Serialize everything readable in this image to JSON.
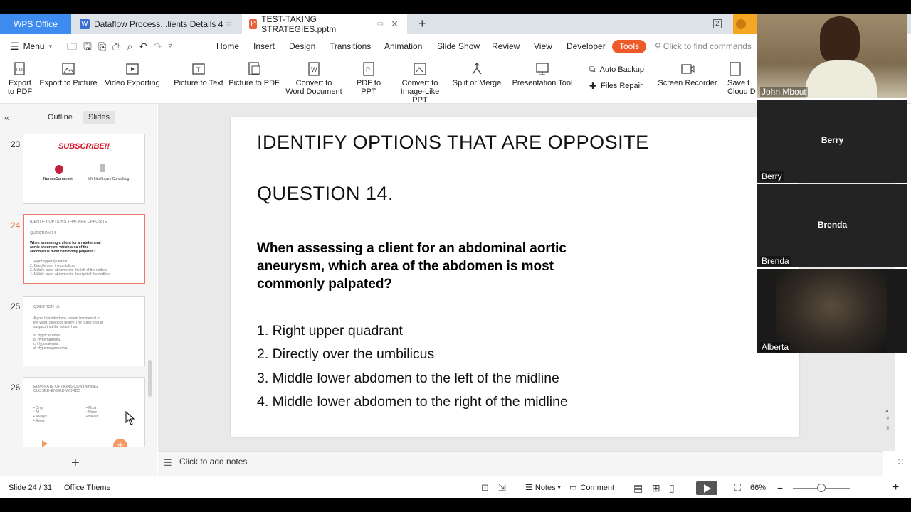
{
  "tabs": {
    "wps": "WPS Office",
    "doc": "Dataflow Process...lients Details 4",
    "ppt": "TEST-TAKING STRATEGIES.pptm",
    "add": "+"
  },
  "menu": {
    "main": "Menu",
    "items": [
      "Home",
      "Insert",
      "Design",
      "Transitions",
      "Animation",
      "Slide Show",
      "Review",
      "View",
      "Developer",
      "Tools"
    ],
    "search": "Click to find commands"
  },
  "ribbon": {
    "export_pdf_1": "Export",
    "export_pdf_2": "to PDF",
    "export_picture": "Export to Picture",
    "video_exporting": "Video Exporting",
    "picture_to_text": "Picture to Text",
    "picture_to_pdf": "Picture to PDF",
    "convert_word_1": "Convert to",
    "convert_word_2": "Word Document",
    "pdf_to_ppt": "PDF to PPT",
    "convert_image_1": "Convert to",
    "convert_image_2": "Image-Like PPT",
    "split_merge": "Split or Merge",
    "presentation_tool": "Presentation Tool",
    "auto_backup": "Auto Backup",
    "files_repair": "Files Repair",
    "screen_recorder": "Screen Recorder",
    "save_cloud_1": "Save t",
    "save_cloud_2": "Cloud D"
  },
  "panel": {
    "outline": "Outline",
    "slides": "Slides",
    "thumbs": [
      {
        "num": "23",
        "title": "SUBSCRIBE!!",
        "a": "NursesCornernet",
        "b": "MN Healthcare Consulting"
      },
      {
        "num": "24",
        "title": "IDENTIFY OPTIONS THAT ARE OPPOSITE",
        "q": "QUESTION 14",
        "body": "When assessing a client for an abdominal aortic aneurysm, which area of the abdomen is most commonly palpated?",
        "o1": "1. Right upper quadrant",
        "o2": "2. Directly over the umbilicus",
        "o3": "3. Middle lower abdomen to the left of the midline",
        "o4": "4. Middle lower abdomen to the right of the midline"
      },
      {
        "num": "25",
        "title": "QUESTION 15.",
        "body": "A post thyroidectomy patient transferred to the ward, develops tetany. The nurse should suspect that the patient has:",
        "o1": "a. Hypocalcemia",
        "o2": "b. Hypernatremia",
        "o3": "c. Hypokalemia",
        "o4": "d. Hypermagnesemia"
      },
      {
        "num": "26",
        "title": "ELIMINATE OPTIONS CONTAINING CLOSED-ENDED WORDS",
        "c1": [
          "• Only",
          "• All",
          "• Always",
          "• Every"
        ],
        "c2": [
          "• Must",
          "• None",
          "• Never"
        ]
      }
    ]
  },
  "slide": {
    "heading": "IDENTIFY OPTIONS THAT ARE OPPOSITE",
    "question_no": "QUESTION 14.",
    "question": "When assessing a client for an abdominal aortic aneurysm, which area of the abdomen is most commonly palpated?",
    "options": [
      "1. Right upper quadrant",
      "2. Directly over the umbilicus",
      "3. Middle lower abdomen to the left of the midline",
      "4. Middle lower abdomen to the right of the midline"
    ]
  },
  "notes_placeholder": "Click to add notes",
  "status": {
    "slide_counter": "Slide 24 / 31",
    "theme": "Office Theme",
    "notes": "Notes",
    "comment": "Comment",
    "zoom": "66%"
  },
  "video": {
    "participants": [
      {
        "name": "John Mbout",
        "center": ""
      },
      {
        "name": "Berry",
        "center": "Berry"
      },
      {
        "name": "Brenda",
        "center": "Brenda"
      },
      {
        "name": "Alberta",
        "center": ""
      }
    ]
  },
  "colors": {
    "accent": "#3f8cf0",
    "tools": "#f05a29",
    "selected_thumb": "#ea7b6b"
  }
}
